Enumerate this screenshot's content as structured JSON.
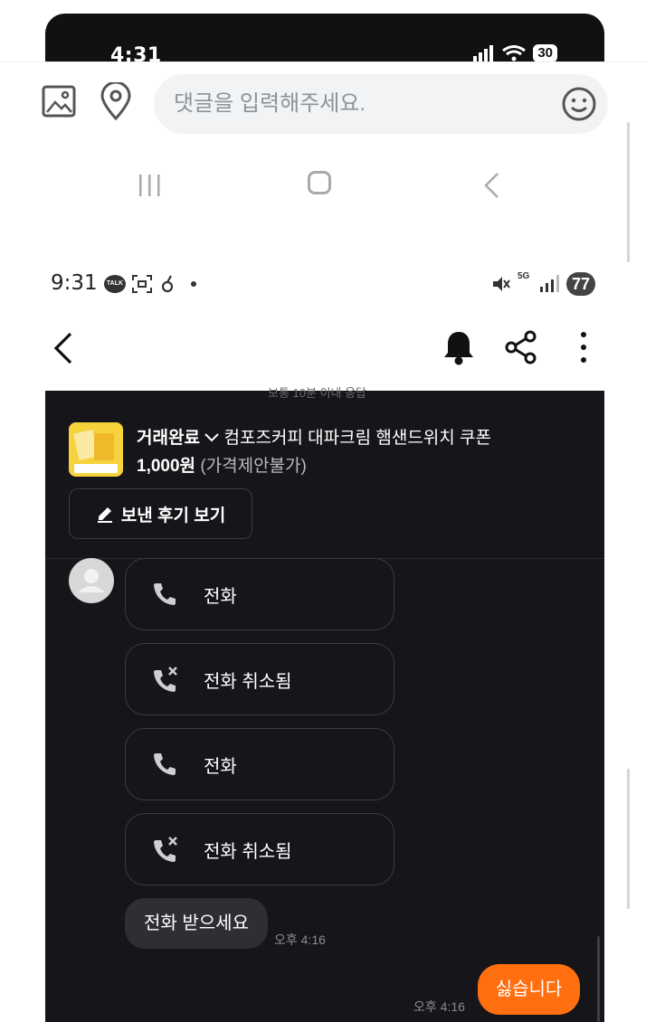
{
  "top_status": {
    "time": "4:31",
    "battery": "30"
  },
  "comment": {
    "placeholder": "댓글을 입력해주세요."
  },
  "status_bar": {
    "time": "9:31",
    "talk_badge": "TALK",
    "battery": "77",
    "network": "5G"
  },
  "chat": {
    "cut_text": "보통 10분 이내 응답",
    "product": {
      "trade_status": "거래완료",
      "title": "컴포즈커피 대파크림 햄샌드위치 쿠폰",
      "price": "1,000원",
      "price_note": "(가격제안불가)"
    },
    "review_button": "보낸 후기 보기",
    "messages": [
      {
        "type": "call",
        "label": "전화",
        "icon": "phone-icon"
      },
      {
        "type": "call",
        "label": "전화 취소됨",
        "icon": "phone-missed-icon"
      },
      {
        "type": "call",
        "label": "전화",
        "icon": "phone-icon"
      },
      {
        "type": "call",
        "label": "전화 취소됨",
        "icon": "phone-missed-icon"
      },
      {
        "type": "text",
        "label": "전화 받으세요",
        "time": "오후 4:16"
      },
      {
        "type": "mine",
        "label": "싫습니다",
        "time": "오후 4:16",
        "color": "#ff6f0f"
      }
    ]
  },
  "colors": {
    "chat_bg": "#16161a",
    "accent": "#ff6f0f"
  }
}
